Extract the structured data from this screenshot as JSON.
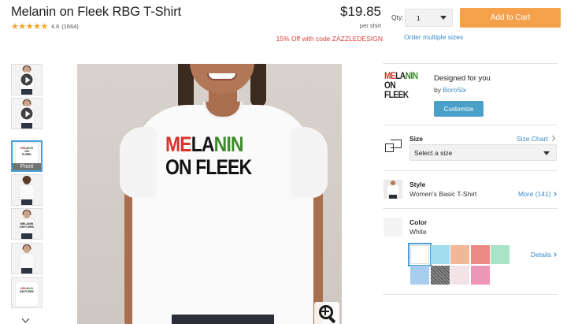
{
  "product": {
    "title": "Melanin on Fleek RBG T-Shirt",
    "stars": "★★★★★",
    "rating": "4.6",
    "review_count": "(1664)"
  },
  "pricing": {
    "price": "$19.85",
    "unit": "per shirt",
    "promo": "15% Off with code ZAZZLEDESIGN"
  },
  "purchase": {
    "qty_label": "Qty:",
    "qty_value": "1",
    "add_to_cart": "Add to Cart",
    "order_multiple": "Order multiple sizes"
  },
  "gallery": {
    "selected_thumb_label": "Front",
    "design_text": {
      "line1": [
        "ME",
        "LA",
        "NIN"
      ],
      "line1_colors": [
        "#d8342c",
        "#151515",
        "#3d8a2c"
      ],
      "line2": "ON FLEEK"
    }
  },
  "designer": {
    "designed_for_you": "Designed for you",
    "by_label": "by",
    "designer_name": "BoroSix",
    "customize": "Customize",
    "thumb_line1": "MELANIN",
    "thumb_line2": "ON FLEEK"
  },
  "size": {
    "label": "Size",
    "size_chart": "Size Chart",
    "placeholder": "Select a size"
  },
  "style": {
    "label": "Style",
    "value": "Women's Basic T-Shirt",
    "more": "More (141)"
  },
  "color": {
    "label": "Color",
    "value": "White",
    "details": "Details",
    "swatches": [
      "#ffffff",
      "#9fdcf0",
      "#f2b896",
      "#ec8a86",
      "#a9e4c8",
      "#a8cdee",
      "heather-gray",
      "#f2e4e6",
      "#ee96b8"
    ]
  }
}
